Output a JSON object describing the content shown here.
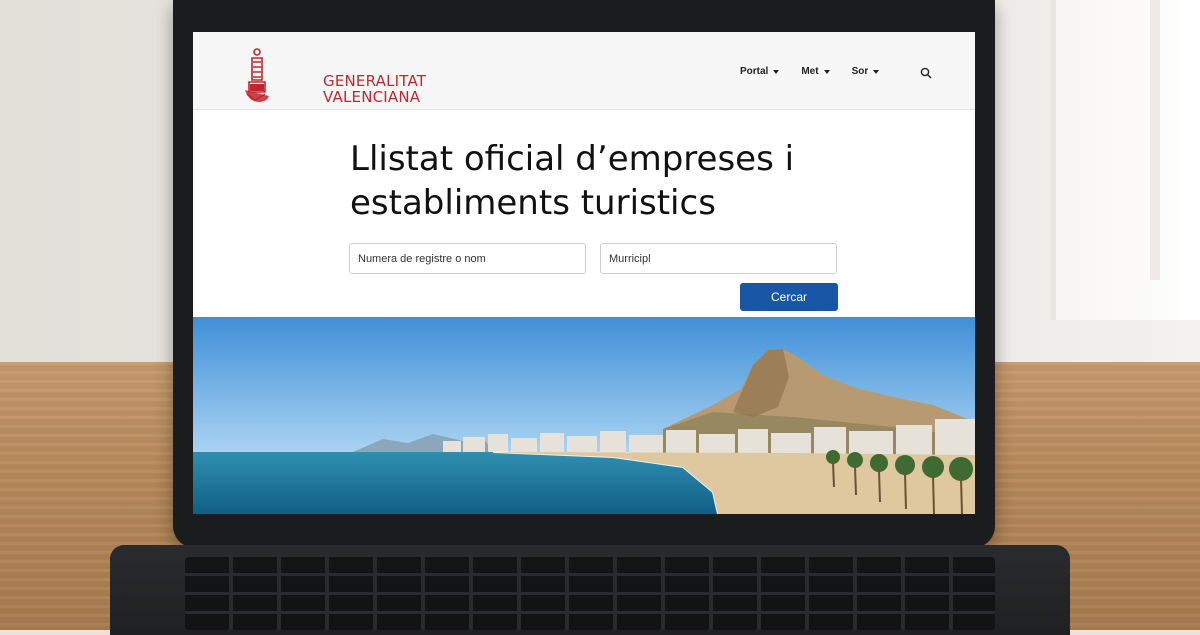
{
  "brand": {
    "line1": "GENERALITAT",
    "line2": "VALENCIANA",
    "color": "#c0272d",
    "emblem_icon": "valencian-crown-emblem-icon"
  },
  "nav": {
    "items": [
      {
        "label": "Portal",
        "icon": "chevron-down-icon"
      },
      {
        "label": "Met",
        "icon": "chevron-down-icon"
      },
      {
        "label": "Sor",
        "icon": "chevron-down-icon"
      }
    ],
    "search_icon": "search-icon"
  },
  "main": {
    "title": "Llistat oficial d’empreses i establiments turistics",
    "search_fields": {
      "name": {
        "value": "",
        "placeholder": "Numera de registre o nom"
      },
      "municipi": {
        "value": "",
        "placeholder": "Murricipl"
      }
    },
    "submit_label": "Cercar",
    "accent_color": "#1757a6"
  },
  "hero": {
    "image": "coastal-city-beach-with-castle-hill-photo"
  }
}
